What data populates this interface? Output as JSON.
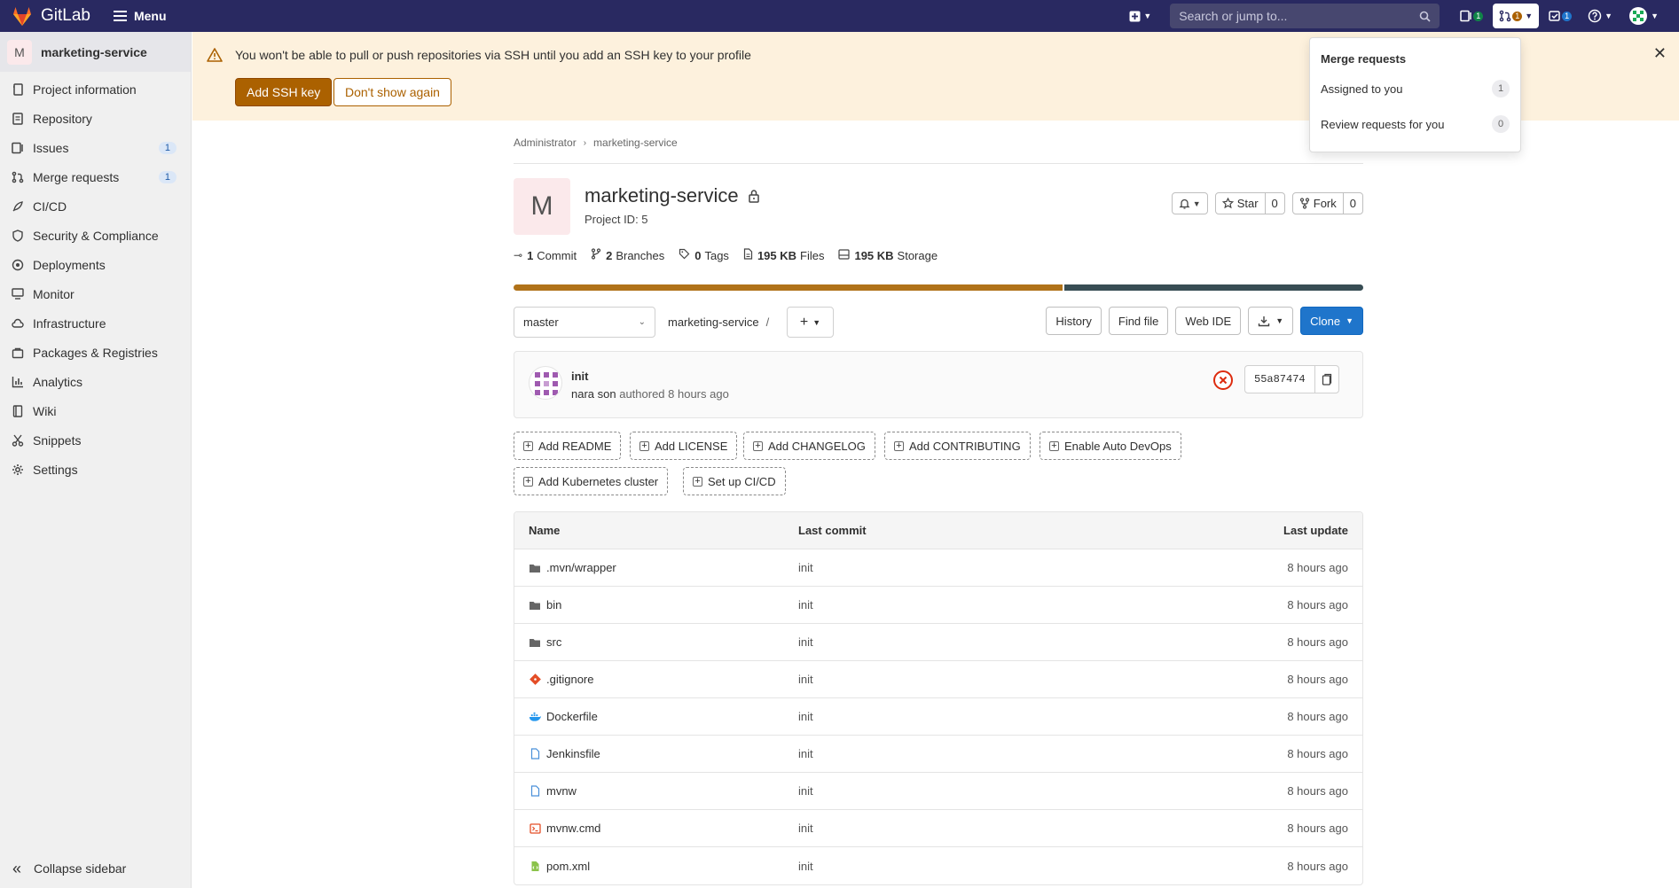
{
  "topbar": {
    "app_name": "GitLab",
    "menu_label": "Menu",
    "search_placeholder": "Search or jump to...",
    "issues_badge": "1",
    "mr_badge": "1",
    "todos_badge": "1"
  },
  "sidebar": {
    "project_initial": "M",
    "project_name": "marketing-service",
    "items": [
      {
        "label": "Project information",
        "icon": "info-icon"
      },
      {
        "label": "Repository",
        "icon": "document-icon"
      },
      {
        "label": "Issues",
        "icon": "issues-icon",
        "count": "1"
      },
      {
        "label": "Merge requests",
        "icon": "merge-request-icon",
        "count": "1"
      },
      {
        "label": "CI/CD",
        "icon": "rocket-icon"
      },
      {
        "label": "Security & Compliance",
        "icon": "shield-icon"
      },
      {
        "label": "Deployments",
        "icon": "deployments-icon"
      },
      {
        "label": "Monitor",
        "icon": "monitor-icon"
      },
      {
        "label": "Infrastructure",
        "icon": "cloud-icon"
      },
      {
        "label": "Packages & Registries",
        "icon": "package-icon"
      },
      {
        "label": "Analytics",
        "icon": "chart-icon"
      },
      {
        "label": "Wiki",
        "icon": "book-icon"
      },
      {
        "label": "Snippets",
        "icon": "snippet-icon"
      },
      {
        "label": "Settings",
        "icon": "gear-icon"
      }
    ],
    "collapse_label": "Collapse sidebar"
  },
  "alert": {
    "message": "You won't be able to pull or push repositories via SSH until you add an SSH key to your profile",
    "primary_label": "Add SSH key",
    "secondary_label": "Don't show again"
  },
  "dropdown": {
    "title": "Merge requests",
    "items": [
      {
        "label": "Assigned to you",
        "count": "1"
      },
      {
        "label": "Review requests for you",
        "count": "0"
      }
    ]
  },
  "breadcrumb": [
    "Administrator",
    "marketing-service"
  ],
  "project": {
    "initial": "M",
    "name": "marketing-service",
    "id_text": "Project ID: 5",
    "star_label": "Star",
    "star_count": "0",
    "fork_label": "Fork",
    "fork_count": "0"
  },
  "stats": [
    {
      "value": "1",
      "label": "Commit",
      "icon": "commit-icon"
    },
    {
      "value": "2",
      "label": "Branches",
      "icon": "branch-icon"
    },
    {
      "value": "0",
      "label": "Tags",
      "icon": "tag-icon"
    },
    {
      "value": "195 KB",
      "label": "Files",
      "icon": "file-icon"
    },
    {
      "value": "195 KB",
      "label": "Storage",
      "icon": "storage-icon"
    }
  ],
  "languages": {
    "colors": [
      "#b07219",
      "#384d54"
    ],
    "shares": [
      0.647,
      0.353
    ]
  },
  "repo": {
    "branch": "master",
    "path": "marketing-service",
    "path_sep": "/",
    "history_label": "History",
    "find_file_label": "Find file",
    "web_ide_label": "Web IDE",
    "clone_label": "Clone"
  },
  "commit": {
    "title": "init",
    "author": "nara son",
    "meta": "authored 8 hours ago",
    "sha": "55a87474"
  },
  "quick_actions": [
    "Add README",
    "Add LICENSE",
    "Add CHANGELOG",
    "Add CONTRIBUTING",
    "Enable Auto DevOps",
    "Add Kubernetes cluster",
    "Set up CI/CD"
  ],
  "tree": {
    "headers": {
      "name": "Name",
      "last_commit": "Last commit",
      "last_update": "Last update"
    },
    "rows": [
      {
        "name": ".mvn/wrapper",
        "icon": "folder-icon",
        "commit": "init",
        "update": "8 hours ago"
      },
      {
        "name": "bin",
        "icon": "folder-icon",
        "commit": "init",
        "update": "8 hours ago"
      },
      {
        "name": "src",
        "icon": "folder-icon",
        "commit": "init",
        "update": "8 hours ago"
      },
      {
        "name": ".gitignore",
        "icon": "git-icon",
        "commit": "init",
        "update": "8 hours ago"
      },
      {
        "name": "Dockerfile",
        "icon": "docker-icon",
        "commit": "init",
        "update": "8 hours ago"
      },
      {
        "name": "Jenkinsfile",
        "icon": "file-icon",
        "commit": "init",
        "update": "8 hours ago"
      },
      {
        "name": "mvnw",
        "icon": "file-icon",
        "commit": "init",
        "update": "8 hours ago"
      },
      {
        "name": "mvnw.cmd",
        "icon": "terminal-file-icon",
        "commit": "init",
        "update": "8 hours ago"
      },
      {
        "name": "pom.xml",
        "icon": "xml-file-icon",
        "commit": "init",
        "update": "8 hours ago"
      }
    ]
  }
}
